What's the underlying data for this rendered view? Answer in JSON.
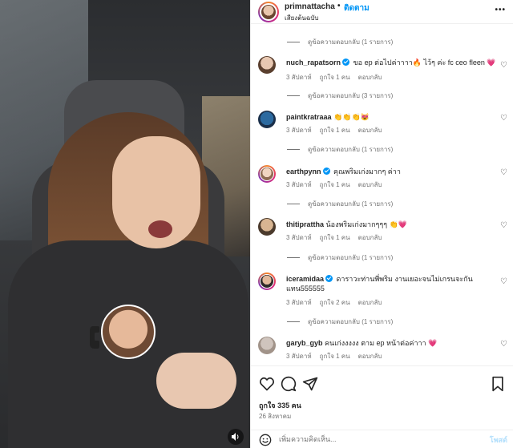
{
  "header": {
    "username": "primnattacha",
    "separator": "•",
    "follow_label": "ติดตาม",
    "subtitle": "เสียงต้นฉบับ",
    "more_icon": "more-horizontal-icon"
  },
  "colors": {
    "link": "#0095f6",
    "muted": "#737373",
    "heart": "#ed4956"
  },
  "comments": {
    "top_replies": "ดูข้อความตอบกลับ (1 รายการ)",
    "items": [
      {
        "username": "nuch_rapatsorn",
        "verified": true,
        "text": "ขอ ep ต่อไปค่าาาา🔥 ไว้ๆ ค่ะ fc ceo fleen 💗",
        "time": "3 สัปดาห์",
        "likes": "ถูกใจ 1 คน",
        "reply": "ตอบกลับ",
        "replies": "ดูข้อความตอบกลับ (3 รายการ)"
      },
      {
        "username": "paintkratraaa",
        "verified": false,
        "text": "👏👏👏😻",
        "time": "3 สัปดาห์",
        "likes": "ถูกใจ 1 คน",
        "reply": "ตอบกลับ",
        "replies": "ดูข้อความตอบกลับ (1 รายการ)"
      },
      {
        "username": "earthpynn",
        "verified": true,
        "text": "คุณพริมเก่งมากๆ ค่าา",
        "time": "3 สัปดาห์",
        "likes": "ถูกใจ 1 คน",
        "reply": "ตอบกลับ",
        "replies": "ดูข้อความตอบกลับ (1 รายการ)"
      },
      {
        "username": "thitiprattha",
        "verified": false,
        "text": "น้องพริมเก่งมากๆๆๆ 👏💗",
        "time": "3 สัปดาห์",
        "likes": "ถูกใจ 1 คน",
        "reply": "ตอบกลับ",
        "replies": "ดูข้อความตอบกลับ (1 รายการ)"
      },
      {
        "username": "iceramidaa",
        "verified": true,
        "text": "ดาราวะท่านพี่พริม งานเยอะจนไม่เกรนจะกันแทน555555",
        "time": "3 สัปดาห์",
        "likes": "ถูกใจ 2 คน",
        "reply": "ตอบกลับ",
        "replies": "ดูข้อความตอบกลับ (1 รายการ)"
      },
      {
        "username": "garyb_gyb",
        "verified": false,
        "text": "คนเก่งงงงง ตาม ep หน้าต่อค่าาา 💗",
        "time": "3 สัปดาห์",
        "likes": "ถูกใจ 1 คน",
        "reply": "ตอบกลับ",
        "replies": ""
      }
    ]
  },
  "actions": {
    "likes": "ถูกใจ 335 คน",
    "date": "26 สิงหาคม"
  },
  "add_comment": {
    "placeholder": "เพิ่มความคิดเห็น...",
    "post_label": "โพสต์"
  }
}
